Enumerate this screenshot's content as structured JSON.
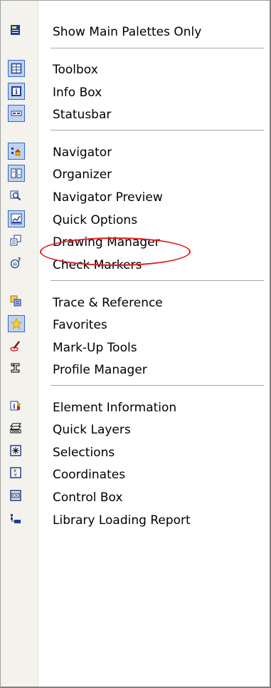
{
  "menu": {
    "items": [
      {
        "label": "Show Main Palettes Only",
        "icon": "palettes-icon",
        "checked": false
      },
      {
        "label": "Toolbox",
        "icon": "toolbox-icon",
        "checked": true
      },
      {
        "label": "Info Box",
        "icon": "info-box-icon",
        "checked": true
      },
      {
        "label": "Statusbar",
        "icon": "statusbar-icon",
        "checked": true
      },
      {
        "label": "Navigator",
        "icon": "navigator-icon",
        "checked": true
      },
      {
        "label": "Organizer",
        "icon": "organizer-icon",
        "checked": true
      },
      {
        "label": "Navigator Preview",
        "icon": "navigator-preview-icon",
        "checked": false
      },
      {
        "label": "Quick Options",
        "icon": "quick-options-icon",
        "checked": true
      },
      {
        "label": "Drawing Manager",
        "icon": "drawing-manager-icon",
        "checked": false
      },
      {
        "label": "Check Markers",
        "icon": "check-markers-icon",
        "checked": false
      },
      {
        "label": "Trace & Reference",
        "icon": "trace-reference-icon",
        "checked": false
      },
      {
        "label": "Favorites",
        "icon": "favorites-icon",
        "checked": true
      },
      {
        "label": "Mark-Up Tools",
        "icon": "markup-tools-icon",
        "checked": false
      },
      {
        "label": "Profile Manager",
        "icon": "profile-manager-icon",
        "checked": false
      },
      {
        "label": "Element Information",
        "icon": "element-information-icon",
        "checked": false
      },
      {
        "label": "Quick Layers",
        "icon": "quick-layers-icon",
        "checked": false
      },
      {
        "label": "Selections",
        "icon": "selections-icon",
        "checked": false
      },
      {
        "label": "Coordinates",
        "icon": "coordinates-icon",
        "checked": false
      },
      {
        "label": "Control Box",
        "icon": "control-box-icon",
        "checked": false
      },
      {
        "label": "Library Loading Report",
        "icon": "library-loading-report-icon",
        "checked": false
      }
    ]
  },
  "colors": {
    "checked_bg": "#c1d2ee",
    "checked_border": "#316ac5",
    "highlight": "#e11a1a"
  }
}
